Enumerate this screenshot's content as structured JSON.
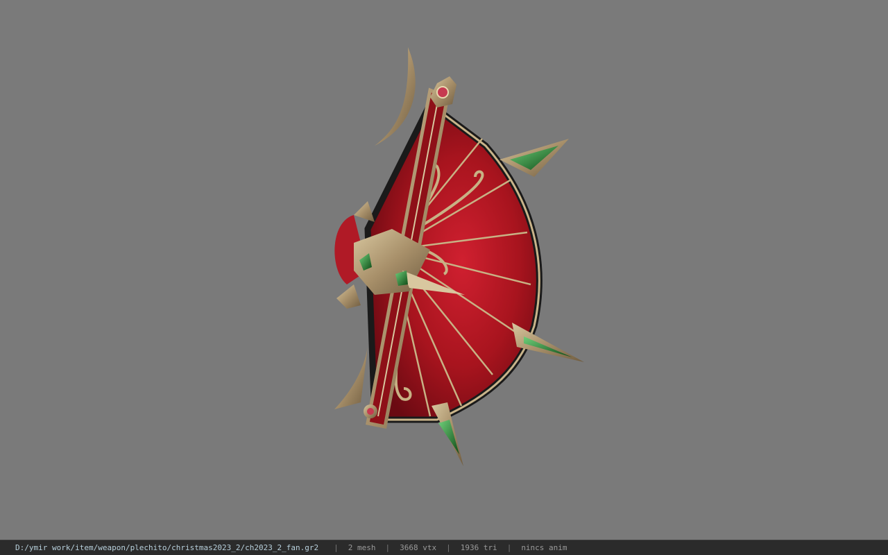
{
  "status_bar": {
    "file_path": "D:/ymir work/item/weapon/plechito/christmas2023_2/ch2023_2_fan.gr2",
    "mesh_count": "2 mesh",
    "vertex_count": "3668 vtx",
    "triangle_count": "1936 tri",
    "animation": "nincs anim"
  },
  "viewport": {
    "background_color": "#7a7a7a",
    "model_description_icon": "ornate-red-fan-weapon-model"
  },
  "colors": {
    "fan_red": "#a8141e",
    "gold_trim": "#b8a27a",
    "gem_green": "#1f7a2a",
    "status_bg": "#2b2b2b"
  }
}
